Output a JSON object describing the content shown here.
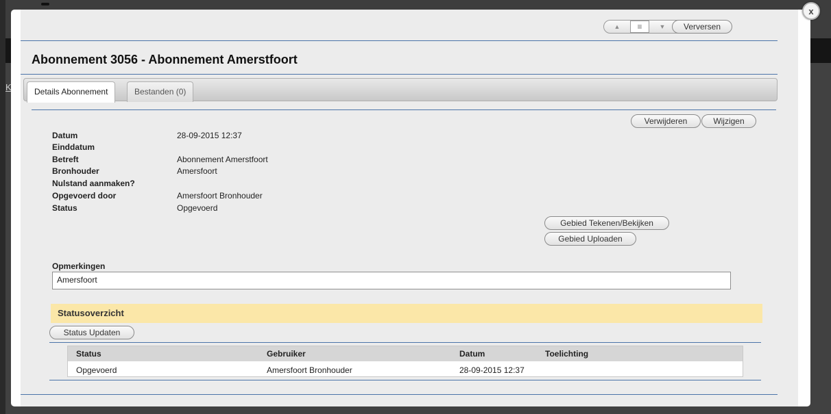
{
  "background": {
    "link_fragment": "K"
  },
  "toolbar": {
    "up_icon": "triangle-up-icon",
    "list_icon": "list-icon",
    "down_icon": "triangle-down-icon",
    "refresh_label": "Verversen"
  },
  "page": {
    "title": "Abonnement 3056 - Abonnement Amerstfoort"
  },
  "tabs": [
    {
      "label": "Details Abonnement",
      "active": true
    },
    {
      "label": "Bestanden (0)",
      "active": false
    }
  ],
  "actions": {
    "delete_label": "Verwijderen",
    "edit_label": "Wijzigen",
    "draw_area_label": "Gebied Tekenen/Bekijken",
    "upload_area_label": "Gebied Uploaden"
  },
  "details": [
    {
      "label": "Datum",
      "value": "28-09-2015 12:37"
    },
    {
      "label": "Einddatum",
      "value": ""
    },
    {
      "label": "Betreft",
      "value": "Abonnement Amerstfoort"
    },
    {
      "label": "Bronhouder",
      "value": "Amersfoort"
    },
    {
      "label": "Nulstand aanmaken?",
      "value": ""
    },
    {
      "label": "Opgevoerd door",
      "value": "Amersfoort Bronhouder"
    },
    {
      "label": "Status",
      "value": "Opgevoerd"
    }
  ],
  "remarks": {
    "label": "Opmerkingen",
    "value": "Amersfoort"
  },
  "status_overview": {
    "title": "Statusoverzicht",
    "update_label": "Status Updaten",
    "columns": [
      "Status",
      "Gebruiker",
      "Datum",
      "Toelichting"
    ],
    "rows": [
      [
        "Opgevoerd",
        "Amersfoort Bronhouder",
        "28-09-2015 12:37",
        ""
      ]
    ]
  },
  "close_label": "x",
  "colors": {
    "accent_line": "#4a73a8",
    "section_bar": "#fbe7a8",
    "table_header": "#d6d6d6"
  }
}
